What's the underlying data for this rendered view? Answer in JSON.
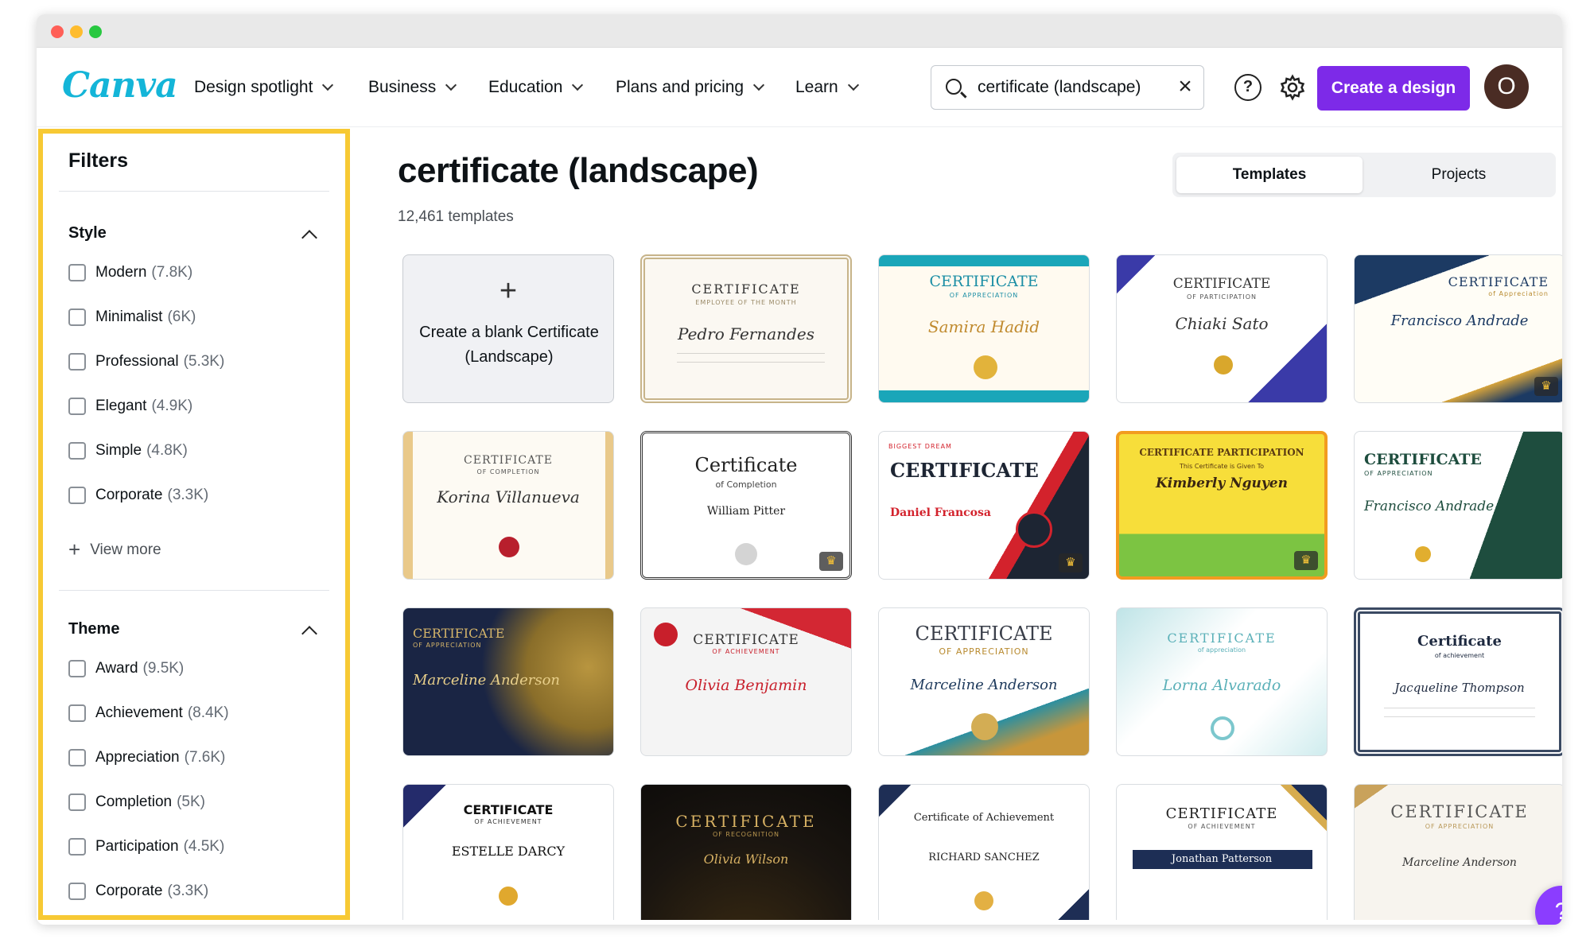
{
  "brand": {
    "logo_text": "Canva",
    "accent": "#7d2ae8",
    "logo_color": "#14b5d8"
  },
  "nav": {
    "items": [
      "Design spotlight",
      "Business",
      "Education",
      "Plans and pricing",
      "Learn"
    ]
  },
  "search": {
    "value": "certificate (landscape)",
    "clear_icon": "close-icon"
  },
  "header": {
    "create_label": "Create a design",
    "avatar_initial": "O",
    "help_icon": "help-icon",
    "settings_icon": "gear-icon"
  },
  "sidebar": {
    "title": "Filters",
    "style": {
      "title": "Style",
      "items": [
        {
          "label": "Modern",
          "count": "(7.8K)"
        },
        {
          "label": "Minimalist",
          "count": "(6K)"
        },
        {
          "label": "Professional",
          "count": "(5.3K)"
        },
        {
          "label": "Elegant",
          "count": "(4.9K)"
        },
        {
          "label": "Simple",
          "count": "(4.8K)"
        },
        {
          "label": "Corporate",
          "count": "(3.3K)"
        }
      ],
      "view_more": "View more"
    },
    "theme": {
      "title": "Theme",
      "items": [
        {
          "label": "Award",
          "count": "(9.5K)"
        },
        {
          "label": "Achievement",
          "count": "(8.4K)"
        },
        {
          "label": "Appreciation",
          "count": "(7.6K)"
        },
        {
          "label": "Completion",
          "count": "(5K)"
        },
        {
          "label": "Participation",
          "count": "(4.5K)"
        },
        {
          "label": "Corporate",
          "count": "(3.3K)"
        }
      ]
    }
  },
  "main": {
    "title": "certificate (landscape)",
    "count": "12,461 templates",
    "tabs": {
      "templates": "Templates",
      "projects": "Projects"
    },
    "blank_card": {
      "plus": "+",
      "text": "Create a blank Certificate (Landscape)"
    },
    "cards": [
      {
        "head": "CERTIFICATE",
        "sub": "EMPLOYEE OF THE MONTH",
        "name": "Pedro Fernandes"
      },
      {
        "head": "CERTIFICATE",
        "sub": "OF APPRECIATION",
        "name": "Samira Hadid"
      },
      {
        "head": "CERTIFICATE",
        "sub": "OF PARTICIPATION",
        "name": "Chiaki Sato"
      },
      {
        "head": "CERTIFICATE",
        "sub": "of Appreciation",
        "name": "Francisco Andrade"
      },
      {
        "head": "CERTIFICATE",
        "sub": "OF COMPLETION",
        "name": "Korina Villanueva"
      },
      {
        "head": "Certificate",
        "sub": "of Completion",
        "name": "William Pitter"
      },
      {
        "head": "CERTIFICATE",
        "sub": "BIGGEST DREAM",
        "name": "Daniel Francosa"
      },
      {
        "head": "CERTIFICATE PARTICIPATION",
        "sub": "This Certificate is Given To",
        "name": "Kimberly Nguyen"
      },
      {
        "head": "CERTIFICATE",
        "sub": "OF APPRECIATION",
        "name": "Francisco Andrade"
      },
      {
        "head": "CERTIFICATE",
        "sub": "OF APPRECIATION",
        "name": "Marceline Anderson"
      },
      {
        "head": "CERTIFICATE",
        "sub": "OF ACHIEVEMENT",
        "name": "Olivia Benjamin"
      },
      {
        "head": "CERTIFICATE",
        "sub": "OF APPRECIATION",
        "name": "Marceline Anderson"
      },
      {
        "head": "CERTIFICATE",
        "sub": "of appreciation",
        "name": "Lorna Alvarado"
      },
      {
        "head": "Certificate",
        "sub": "of achievement",
        "name": "Jacqueline Thompson"
      },
      {
        "head": "CERTIFICATE",
        "sub": "OF ACHIEVEMENT",
        "name": "ESTELLE DARCY"
      },
      {
        "head": "CERTIFICATE",
        "sub": "OF RECOGNITION",
        "name": "Olivia Wilson"
      },
      {
        "head": "Certificate of Achievement",
        "sub": "",
        "name": "RICHARD SANCHEZ"
      },
      {
        "head": "CERTIFICATE",
        "sub": "OF ACHIEVEMENT",
        "name": "Jonathan Patterson"
      },
      {
        "head": "CERTIFICATE",
        "sub": "OF APPRECIATION",
        "name": "Marceline Anderson"
      }
    ]
  },
  "fab": {
    "label": "?"
  }
}
